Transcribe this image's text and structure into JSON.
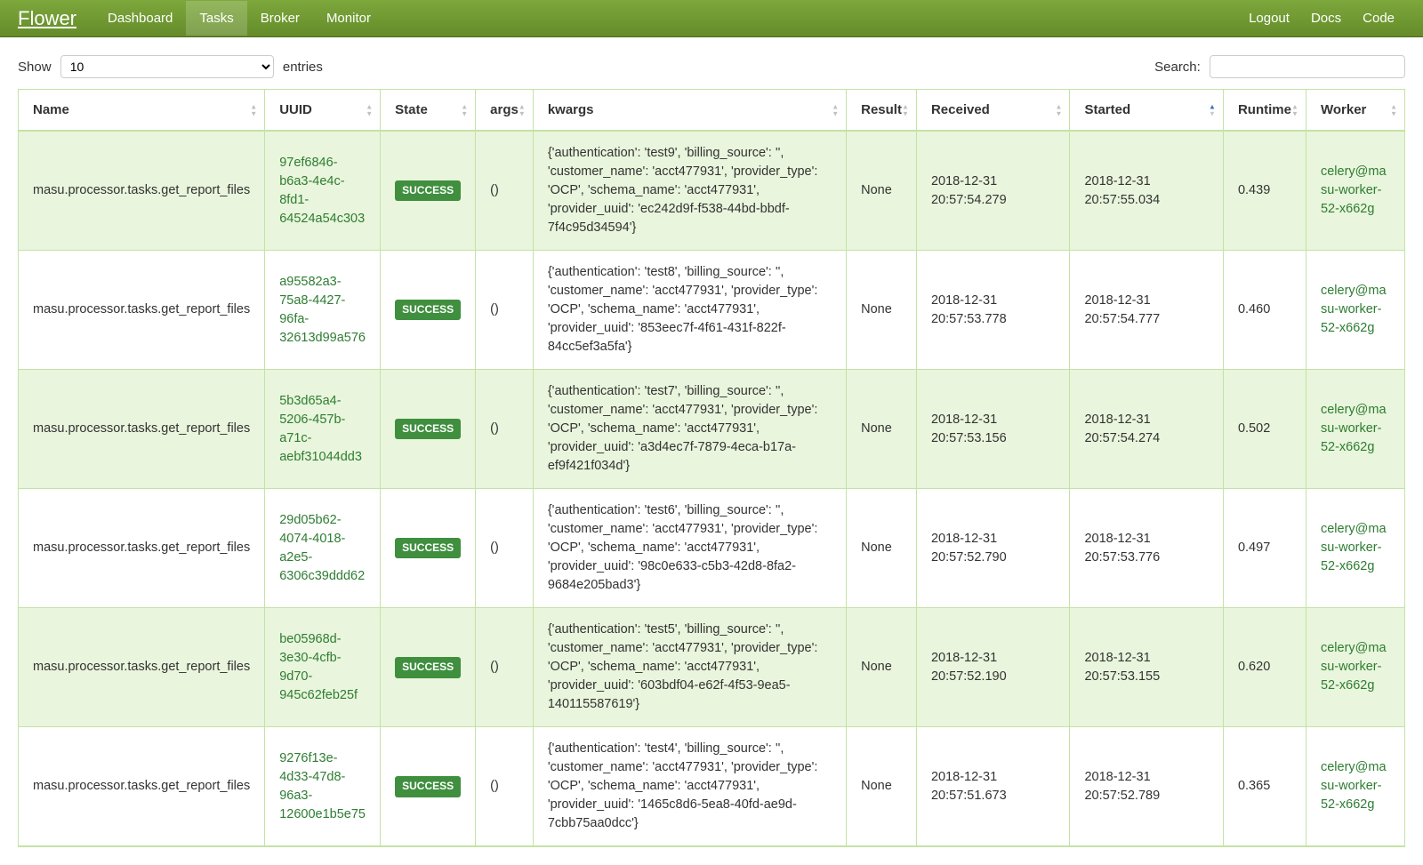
{
  "brand": "Flower",
  "nav": {
    "items": [
      {
        "label": "Dashboard",
        "active": false
      },
      {
        "label": "Tasks",
        "active": true
      },
      {
        "label": "Broker",
        "active": false
      },
      {
        "label": "Monitor",
        "active": false
      }
    ],
    "right": [
      {
        "label": "Logout"
      },
      {
        "label": "Docs"
      },
      {
        "label": "Code"
      }
    ]
  },
  "controls": {
    "show_label": "Show",
    "entries_label": "entries",
    "page_size": "10",
    "search_label": "Search:",
    "search_value": ""
  },
  "columns": [
    {
      "label": "Name",
      "sorted": ""
    },
    {
      "label": "UUID",
      "sorted": ""
    },
    {
      "label": "State",
      "sorted": ""
    },
    {
      "label": "args",
      "sorted": ""
    },
    {
      "label": "kwargs",
      "sorted": ""
    },
    {
      "label": "Result",
      "sorted": ""
    },
    {
      "label": "Received",
      "sorted": ""
    },
    {
      "label": "Started",
      "sorted": "asc"
    },
    {
      "label": "Runtime",
      "sorted": ""
    },
    {
      "label": "Worker",
      "sorted": ""
    }
  ],
  "rows": [
    {
      "name": "masu.processor.tasks.get_report_files",
      "uuid": "97ef6846-b6a3-4e4c-8fd1-64524a54c303",
      "state": "SUCCESS",
      "args": "()",
      "kwargs": "{'authentication': 'test9', 'billing_source': '', 'customer_name': 'acct477931', 'provider_type': 'OCP', 'schema_name': 'acct477931', 'provider_uuid': 'ec242d9f-f538-44bd-bbdf-7f4c95d34594'}",
      "result": "None",
      "received": "2018-12-31 20:57:54.279",
      "started": "2018-12-31 20:57:55.034",
      "runtime": "0.439",
      "worker": "celery@masu-worker-52-x662g"
    },
    {
      "name": "masu.processor.tasks.get_report_files",
      "uuid": "a95582a3-75a8-4427-96fa-32613d99a576",
      "state": "SUCCESS",
      "args": "()",
      "kwargs": "{'authentication': 'test8', 'billing_source': '', 'customer_name': 'acct477931', 'provider_type': 'OCP', 'schema_name': 'acct477931', 'provider_uuid': '853eec7f-4f61-431f-822f-84cc5ef3a5fa'}",
      "result": "None",
      "received": "2018-12-31 20:57:53.778",
      "started": "2018-12-31 20:57:54.777",
      "runtime": "0.460",
      "worker": "celery@masu-worker-52-x662g"
    },
    {
      "name": "masu.processor.tasks.get_report_files",
      "uuid": "5b3d65a4-5206-457b-a71c-aebf31044dd3",
      "state": "SUCCESS",
      "args": "()",
      "kwargs": "{'authentication': 'test7', 'billing_source': '', 'customer_name': 'acct477931', 'provider_type': 'OCP', 'schema_name': 'acct477931', 'provider_uuid': 'a3d4ec7f-7879-4eca-b17a-ef9f421f034d'}",
      "result": "None",
      "received": "2018-12-31 20:57:53.156",
      "started": "2018-12-31 20:57:54.274",
      "runtime": "0.502",
      "worker": "celery@masu-worker-52-x662g"
    },
    {
      "name": "masu.processor.tasks.get_report_files",
      "uuid": "29d05b62-4074-4018-a2e5-6306c39ddd62",
      "state": "SUCCESS",
      "args": "()",
      "kwargs": "{'authentication': 'test6', 'billing_source': '', 'customer_name': 'acct477931', 'provider_type': 'OCP', 'schema_name': 'acct477931', 'provider_uuid': '98c0e633-c5b3-42d8-8fa2-9684e205bad3'}",
      "result": "None",
      "received": "2018-12-31 20:57:52.790",
      "started": "2018-12-31 20:57:53.776",
      "runtime": "0.497",
      "worker": "celery@masu-worker-52-x662g"
    },
    {
      "name": "masu.processor.tasks.get_report_files",
      "uuid": "be05968d-3e30-4cfb-9d70-945c62feb25f",
      "state": "SUCCESS",
      "args": "()",
      "kwargs": "{'authentication': 'test5', 'billing_source': '', 'customer_name': 'acct477931', 'provider_type': 'OCP', 'schema_name': 'acct477931', 'provider_uuid': '603bdf04-e62f-4f53-9ea5-140115587619'}",
      "result": "None",
      "received": "2018-12-31 20:57:52.190",
      "started": "2018-12-31 20:57:53.155",
      "runtime": "0.620",
      "worker": "celery@masu-worker-52-x662g"
    },
    {
      "name": "masu.processor.tasks.get_report_files",
      "uuid": "9276f13e-4d33-47d8-96a3-12600e1b5e75",
      "state": "SUCCESS",
      "args": "()",
      "kwargs": "{'authentication': 'test4', 'billing_source': '', 'customer_name': 'acct477931', 'provider_type': 'OCP', 'schema_name': 'acct477931', 'provider_uuid': '1465c8d6-5ea8-40fd-ae9d-7cbb75aa0dcc'}",
      "result": "None",
      "received": "2018-12-31 20:57:51.673",
      "started": "2018-12-31 20:57:52.789",
      "runtime": "0.365",
      "worker": "celery@masu-worker-52-x662g"
    }
  ]
}
